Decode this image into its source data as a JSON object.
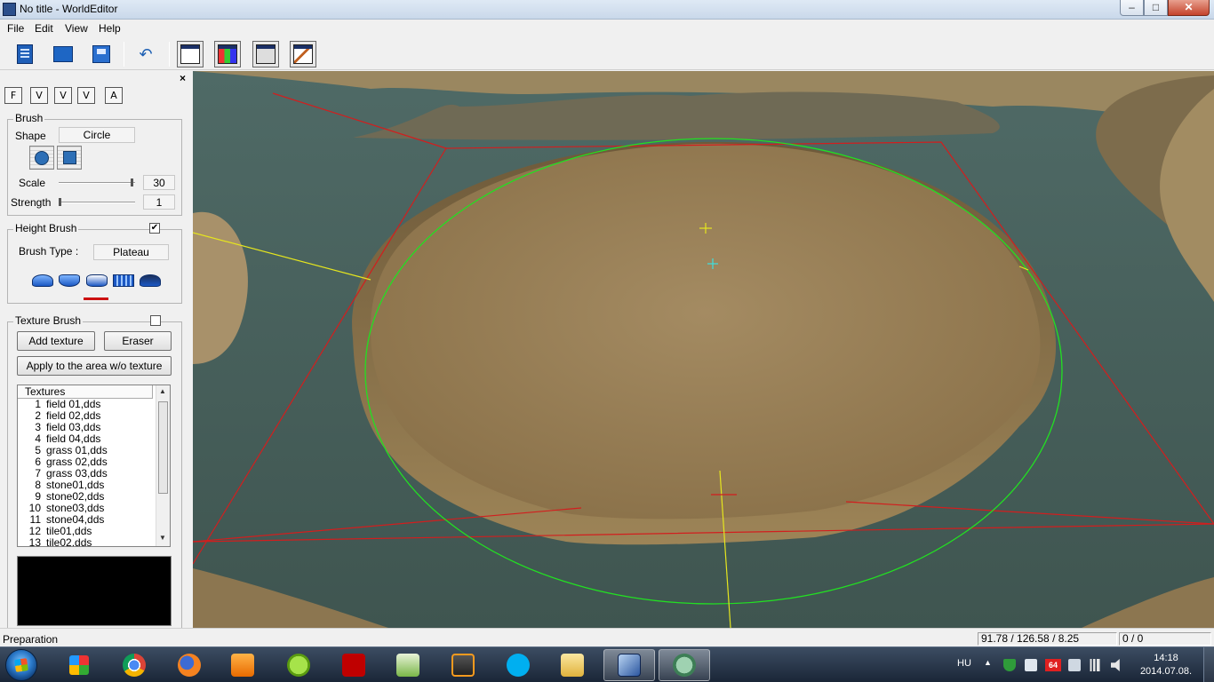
{
  "window": {
    "title": "No title - WorldEditor",
    "controls": {
      "minimize": "–",
      "maximize": "□",
      "close": "✕"
    }
  },
  "menu": [
    "File",
    "Edit",
    "View",
    "Help"
  ],
  "toolbar": {
    "buttons": [
      "new-document-icon",
      "open-folder-icon",
      "save-icon",
      "undo-icon",
      "panel-objects-icon",
      "panel-palette-icon",
      "panel-grid-icon",
      "panel-edit-icon"
    ]
  },
  "panel": {
    "close": "×",
    "mode_buttons": [
      "F",
      "V",
      "V",
      "V",
      "A"
    ],
    "brush": {
      "title": "Brush",
      "shape_label": "Shape",
      "shape_value": "Circle",
      "scale_label": "Scale",
      "scale_value": "30",
      "scale_fraction": 0.98,
      "strength_label": "Strength",
      "strength_value": "1",
      "strength_fraction": 0.0
    },
    "height_brush": {
      "title": "Height Brush",
      "checked": true,
      "check_glyph": "✔",
      "type_label": "Brush Type :",
      "type_value": "Plateau",
      "selected_index": 2
    },
    "texture_brush": {
      "title": "Texture Brush",
      "checked": false,
      "add_texture": "Add texture",
      "eraser": "Eraser",
      "apply_area": "Apply to the area w/o texture",
      "list_header": "Textures",
      "textures": [
        {
          "n": "1",
          "name": "field 01,dds"
        },
        {
          "n": "2",
          "name": "field 02,dds"
        },
        {
          "n": "3",
          "name": "field 03,dds"
        },
        {
          "n": "4",
          "name": "field 04,dds"
        },
        {
          "n": "5",
          "name": "grass 01,dds"
        },
        {
          "n": "6",
          "name": "grass 02,dds"
        },
        {
          "n": "7",
          "name": "grass 03,dds"
        },
        {
          "n": "8",
          "name": "stone01,dds"
        },
        {
          "n": "9",
          "name": "stone02,dds"
        },
        {
          "n": "10",
          "name": "stone03,dds"
        },
        {
          "n": "11",
          "name": "stone04,dds"
        },
        {
          "n": "12",
          "name": "tile01,dds"
        },
        {
          "n": "13",
          "name": "tile02,dds"
        }
      ]
    }
  },
  "colors": {
    "terrain": "#9c835a",
    "water": "#4a605b",
    "brush_circle": "#22e022",
    "selection_box": "#d21e1e",
    "axis": "#e6e61e"
  },
  "status": {
    "mode": "Preparation",
    "coords": "91.78 / 126.58 / 8.25",
    "counter": "0 / 0"
  },
  "taskbar": {
    "apps": [
      "chrome-icon",
      "firefox-icon",
      "media-player-icon",
      "paw-icon",
      "filezilla-icon",
      "notepad-icon",
      "sublime-icon",
      "skype-icon",
      "explorer-icon",
      "worldeditor-icon",
      "tortoise-icon"
    ],
    "language": "HU",
    "badge": "64",
    "time": "14:18",
    "date": "2014.07.08."
  }
}
